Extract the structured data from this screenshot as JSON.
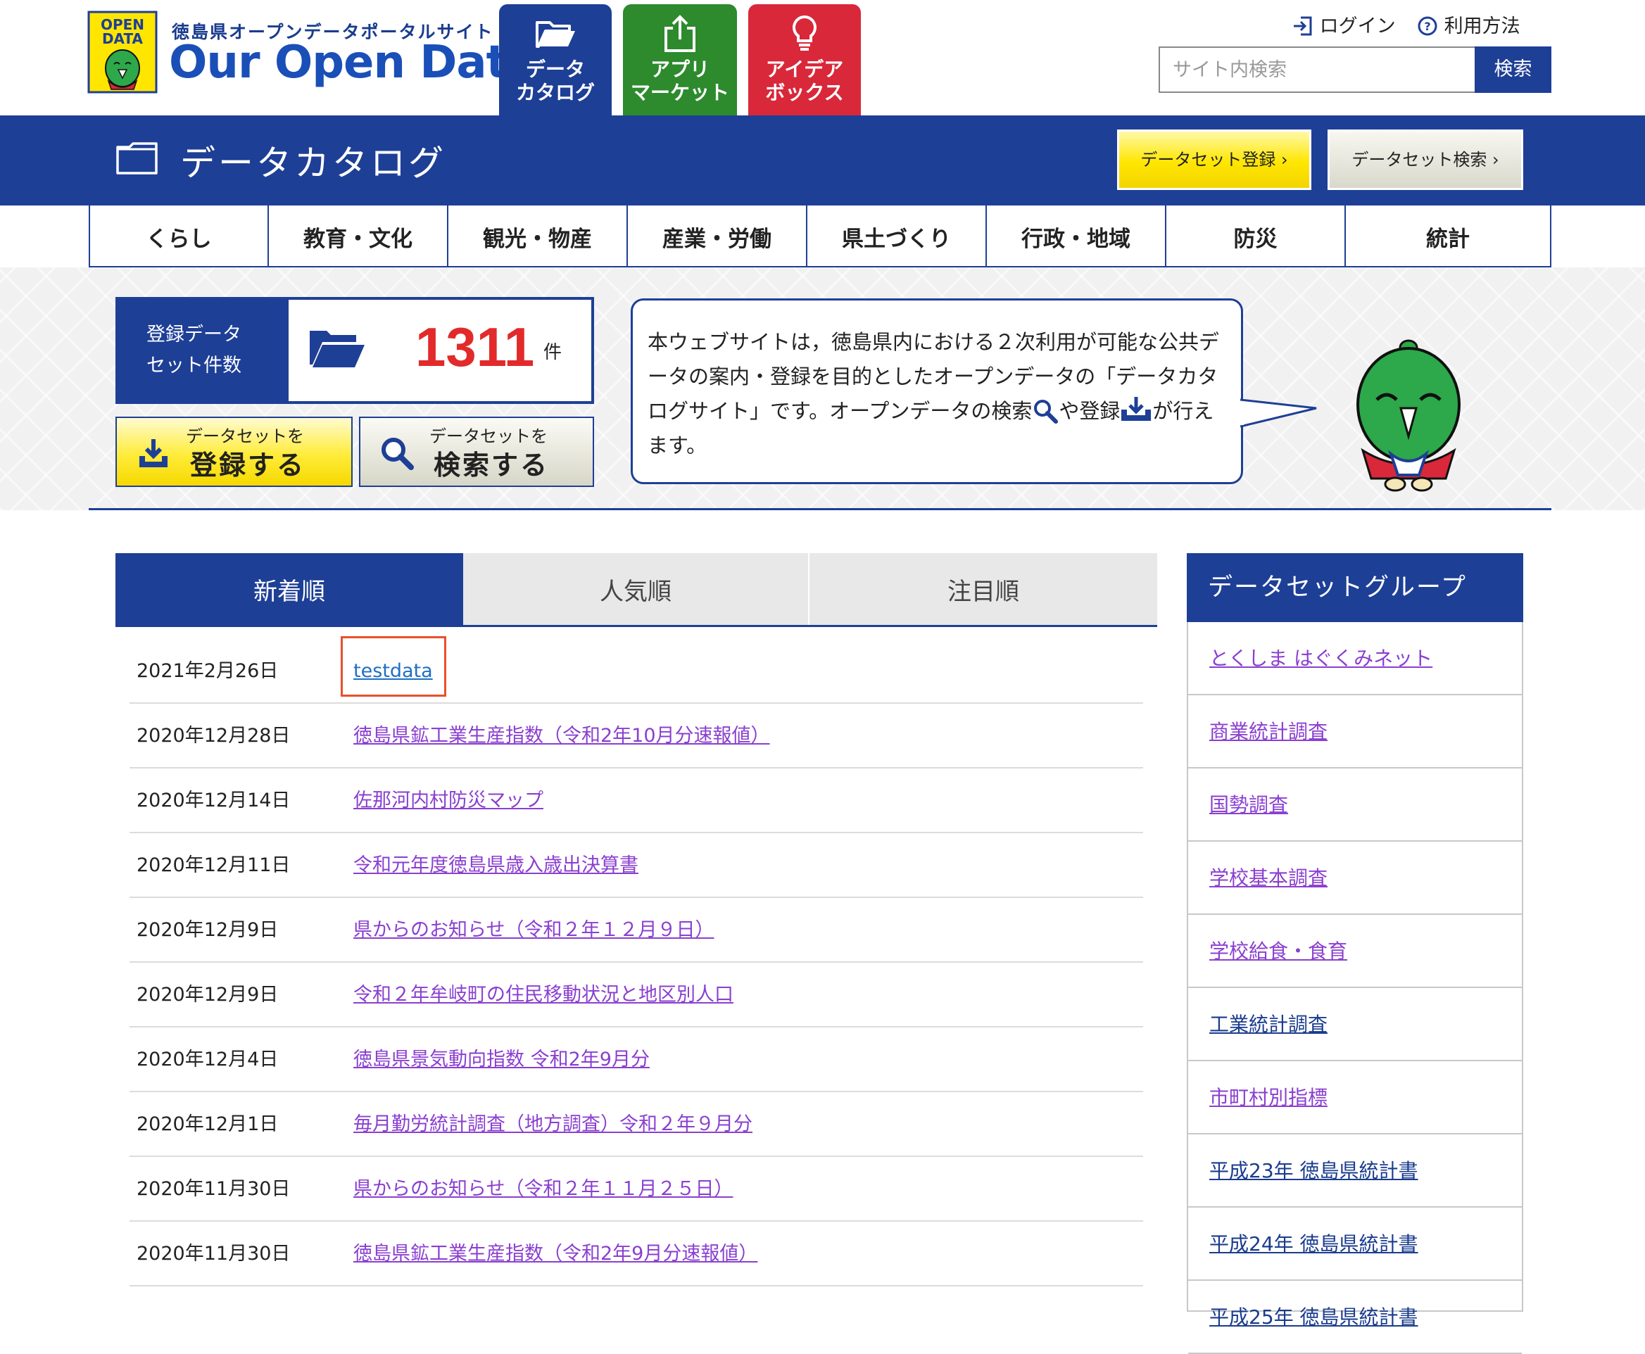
{
  "header": {
    "badge_text": "OPEN DATA",
    "site_subtitle": "徳島県オープンデータポータルサイト",
    "site_title": "Our Open Data",
    "nav": [
      {
        "label": "データ\nカタログ",
        "icon": "folder-open-icon",
        "color": "#1e3f96"
      },
      {
        "label": "アプリ\nマーケット",
        "icon": "share-upload-icon",
        "color": "#2d8a2d"
      },
      {
        "label": "アイデア\nボックス",
        "icon": "lightbulb-icon",
        "color": "#d8283a"
      }
    ],
    "login_label": "ログイン",
    "help_label": "利用方法",
    "search_placeholder": "サイト内検索",
    "search_button": "検索"
  },
  "catalog_bar": {
    "title": "データカタログ",
    "register_button": "データセット登録 ›",
    "search_button": "データセット検索 ›"
  },
  "categories": [
    "くらし",
    "教育・文化",
    "観光・物産",
    "産業・労働",
    "県土づくり",
    "行政・地域",
    "防災",
    "統計"
  ],
  "hero": {
    "count_label": "登録データ\nセット件数",
    "count_value": "1311",
    "count_unit": "件",
    "register_small": "データセットを",
    "register_big": "登録する",
    "search_small": "データセットを",
    "search_big": "検索する",
    "bubble_text_1": "本ウェブサイトは，徳島県内における２次利用が可能な公共データの案内・登録を目的としたオープンデータの「データカタログサイト」です。オープンデータの検索",
    "bubble_text_2": "や登録",
    "bubble_text_3": "が行えます。"
  },
  "tabs": [
    "新着順",
    "人気順",
    "注目順"
  ],
  "datasets": [
    {
      "date": "2021年2月26日",
      "title": "testdata"
    },
    {
      "date": "2020年12月28日",
      "title": "徳島県鉱工業生産指数（令和2年10月分速報値）"
    },
    {
      "date": "2020年12月14日",
      "title": "佐那河内村防災マップ"
    },
    {
      "date": "2020年12月11日",
      "title": "令和元年度徳島県歳入歳出決算書"
    },
    {
      "date": "2020年12月9日",
      "title": "県からのお知らせ（令和２年１２月９日）"
    },
    {
      "date": "2020年12月9日",
      "title": "令和２年牟岐町の住民移動状況と地区別人口"
    },
    {
      "date": "2020年12月4日",
      "title": "徳島県景気動向指数 令和2年9月分"
    },
    {
      "date": "2020年12月1日",
      "title": "毎月勤労統計調査（地方調査）令和２年９月分"
    },
    {
      "date": "2020年11月30日",
      "title": "県からのお知らせ（令和２年１１月２５日）"
    },
    {
      "date": "2020年11月30日",
      "title": "徳島県鉱工業生産指数（令和2年9月分速報値）"
    }
  ],
  "sidebar": {
    "title": "データセットグループ",
    "groups": [
      {
        "label": "とくしま はぐくみネット",
        "visited": true
      },
      {
        "label": "商業統計調査",
        "visited": true
      },
      {
        "label": "国勢調査",
        "visited": true
      },
      {
        "label": "学校基本調査",
        "visited": true
      },
      {
        "label": "学校給食・食育",
        "visited": true
      },
      {
        "label": "工業統計調査",
        "visited": false
      },
      {
        "label": "市町村別指標",
        "visited": true
      },
      {
        "label": "平成23年 徳島県統計書",
        "visited": false
      },
      {
        "label": "平成24年 徳島県統計書",
        "visited": false
      },
      {
        "label": "平成25年 徳島県統計書",
        "visited": false
      }
    ]
  }
}
